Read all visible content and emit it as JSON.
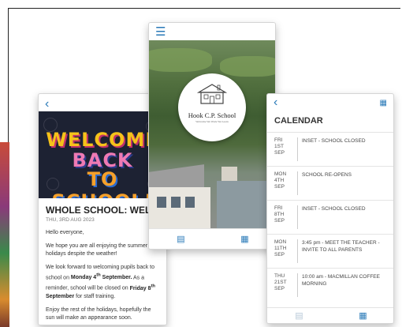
{
  "news": {
    "back_icon": "chevron-left-icon",
    "hero": {
      "line1": "WELCOME",
      "line2": "BACK",
      "line3": "TO SCHOOL!"
    },
    "title": "WHOLE SCHOOL: WELCOME BACK",
    "date": "THU, 3RD AUG 2023",
    "greeting": "Hello everyone,",
    "para1": "We hope you are all enjoying the summer holidays despite the weather!",
    "para2_a": "We look forward to welcoming pupils back to school on ",
    "para2_b": "Monday 4",
    "para2_b_sup": "th",
    "para2_c": " September.",
    "para2_d": " As a reminder, school will be closed on ",
    "para2_e": "Friday 8",
    "para2_e_sup": "th",
    "para2_f": " September",
    "para2_g": " for staff training.",
    "para3": "Enjoy the rest of the holidays, hopefully the sun will make an appearance soon."
  },
  "home": {
    "menu_icon": "hamburger-menu-icon",
    "school_name": "Hook C.P. School",
    "motto": "Welcome We Work We Learn",
    "tabs": [
      "news-icon",
      "calendar-icon"
    ]
  },
  "calendar": {
    "title": "CALENDAR",
    "events": [
      {
        "date": "FRI\n1ST\nSEP",
        "event": "INSET - SCHOOL CLOSED"
      },
      {
        "date": "MON\n4TH\nSEP",
        "event": "SCHOOL RE-OPENS"
      },
      {
        "date": "FRI\n8TH\nSEP",
        "event": "INSET - SCHOOL CLOSED"
      },
      {
        "date": "MON\n11TH\nSEP",
        "event": "3:45 pm - MEET THE TEACHER - INVITE TO ALL PARENTS"
      },
      {
        "date": "THU\n21ST\nSEP",
        "event": "10:00 am - MACMILLAN COFFEE MORNING"
      }
    ]
  },
  "colors": {
    "accent": "#2a7ab8"
  }
}
